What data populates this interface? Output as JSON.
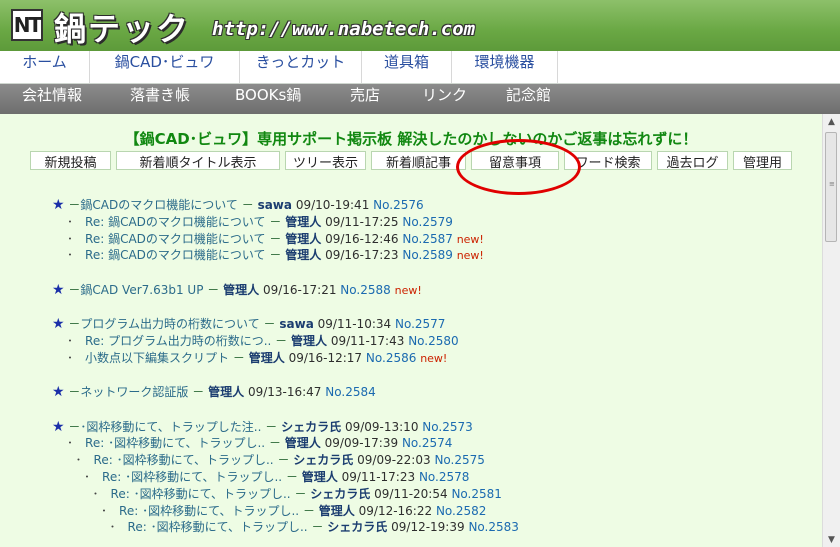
{
  "header": {
    "logo_mark": "NT",
    "logo_text": "鍋テック",
    "site_url": "http://www.nabetech.com"
  },
  "nav_primary": [
    "ホーム",
    "鍋CAD･ビュワ",
    "きっとカット",
    "道具箱",
    "環境機器"
  ],
  "nav_secondary": [
    "会社情報",
    "落書き帳",
    "BOOKs鍋",
    "売店",
    "リンク",
    "記念館"
  ],
  "board": {
    "title": "【鍋CAD･ビュワ】専用サポート掲示板 解決したのかしないのかご返事は忘れずに！",
    "menu": [
      "新規投稿",
      "新着順タイトル表示",
      "ツリー表示",
      "新着順記事",
      "留意事項",
      "ワード検索",
      "過去ログ",
      "管理用"
    ]
  },
  "threads": [
    {
      "rows": [
        {
          "level": 0,
          "subject": "鍋CADのマクロ機能について",
          "author": "sawa",
          "date": "09/10-19:41",
          "no": "No.2576",
          "new": ""
        },
        {
          "level": 1,
          "subject": "Re: 鍋CADのマクロ機能について",
          "author": "管理人",
          "date": "09/11-17:25",
          "no": "No.2579",
          "new": ""
        },
        {
          "level": 1,
          "subject": "Re: 鍋CADのマクロ機能について",
          "author": "管理人",
          "date": "09/16-12:46",
          "no": "No.2587",
          "new": "new!"
        },
        {
          "level": 1,
          "subject": "Re: 鍋CADのマクロ機能について",
          "author": "管理人",
          "date": "09/16-17:23",
          "no": "No.2589",
          "new": "new!"
        }
      ]
    },
    {
      "rows": [
        {
          "level": 0,
          "subject": "鍋CAD Ver7.63b1 UP",
          "author": "管理人",
          "date": "09/16-17:21",
          "no": "No.2588",
          "new": "new!"
        }
      ]
    },
    {
      "rows": [
        {
          "level": 0,
          "subject": "プログラム出力時の桁数について",
          "author": "sawa",
          "date": "09/11-10:34",
          "no": "No.2577",
          "new": ""
        },
        {
          "level": 1,
          "subject": "Re: プログラム出力時の桁数につ..",
          "author": "管理人",
          "date": "09/11-17:43",
          "no": "No.2580",
          "new": ""
        },
        {
          "level": 1,
          "subject": "小数点以下編集スクリプト",
          "author": "管理人",
          "date": "09/16-12:17",
          "no": "No.2586",
          "new": "new!"
        }
      ]
    },
    {
      "rows": [
        {
          "level": 0,
          "subject": "ネットワーク認証版",
          "author": "管理人",
          "date": "09/13-16:47",
          "no": "No.2584",
          "new": ""
        }
      ]
    },
    {
      "rows": [
        {
          "level": 0,
          "subject": "･図枠移動にて、トラップした注..",
          "author": "シェカラ氏",
          "date": "09/09-13:10",
          "no": "No.2573",
          "new": ""
        },
        {
          "level": 1,
          "subject": "Re: ･図枠移動にて、トラップし..",
          "author": "管理人",
          "date": "09/09-17:39",
          "no": "No.2574",
          "new": ""
        },
        {
          "level": 2,
          "subject": "Re: ･図枠移動にて、トラップし..",
          "author": "シェカラ氏",
          "date": "09/09-22:03",
          "no": "No.2575",
          "new": ""
        },
        {
          "level": 3,
          "subject": "Re: ･図枠移動にて、トラップし..",
          "author": "管理人",
          "date": "09/11-17:23",
          "no": "No.2578",
          "new": ""
        },
        {
          "level": 4,
          "subject": "Re: ･図枠移動にて、トラップし..",
          "author": "シェカラ氏",
          "date": "09/11-20:54",
          "no": "No.2581",
          "new": ""
        },
        {
          "level": 5,
          "subject": "Re: ･図枠移動にて、トラップし..",
          "author": "管理人",
          "date": "09/12-16:22",
          "no": "No.2582",
          "new": ""
        },
        {
          "level": 6,
          "subject": "Re: ･図枠移動にて、トラップし..",
          "author": "シェカラ氏",
          "date": "09/12-19:39",
          "no": "No.2583",
          "new": ""
        }
      ]
    }
  ],
  "symbols": {
    "star": "★",
    "bullet": "･",
    "dash": "－"
  },
  "colors": {
    "header_green": "#6aa844",
    "content_bg": "#eefce4",
    "title_green": "#118811",
    "annotation_red": "#e00000",
    "new_red": "#cc2200"
  }
}
